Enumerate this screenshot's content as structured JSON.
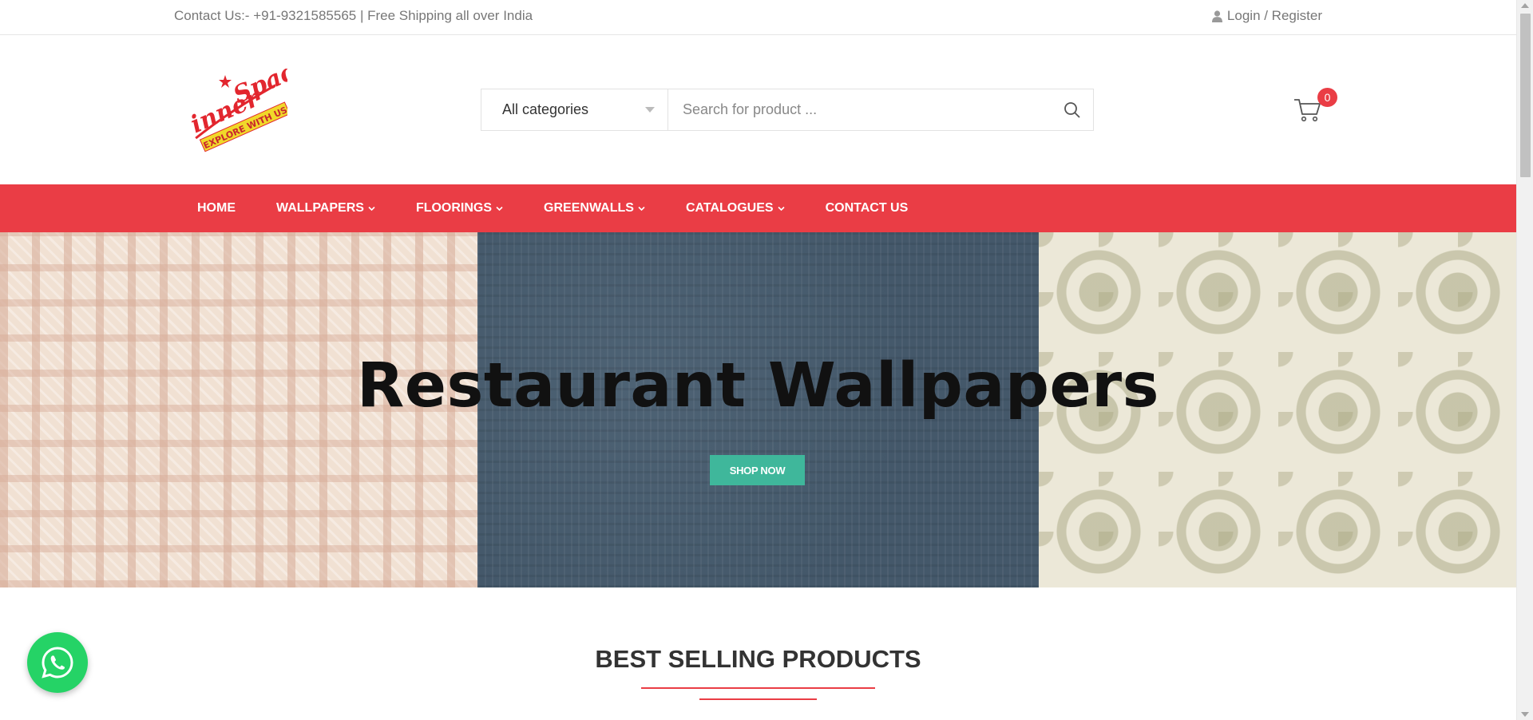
{
  "topbar": {
    "contact_text": "Contact Us:- +91-9321585565 | Free Shipping all over India",
    "login_text": "Login / Register",
    "login_icon": "user-icon"
  },
  "logo": {
    "brand_text": "innerSpace",
    "tagline": "EXPLORE WITH US"
  },
  "search": {
    "category_selected": "All categories",
    "placeholder": "Search for product ...",
    "icon": "search-icon"
  },
  "cart": {
    "icon": "cart-icon",
    "count": "0"
  },
  "nav": {
    "items": [
      {
        "label": "HOME",
        "dropdown": false
      },
      {
        "label": "WALLPAPERS",
        "dropdown": true
      },
      {
        "label": "FLOORINGS",
        "dropdown": true
      },
      {
        "label": "GREENWALLS",
        "dropdown": true
      },
      {
        "label": "CATALOGUES",
        "dropdown": true
      },
      {
        "label": "CONTACT US",
        "dropdown": false
      }
    ]
  },
  "hero": {
    "title": "Restaurant Wallpapers",
    "button_label": "SHOP NOW"
  },
  "section": {
    "title": "BEST SELLING PRODUCTS"
  },
  "whatsapp": {
    "icon": "whatsapp-icon"
  },
  "colors": {
    "accent_red": "#ea3d45",
    "button_teal": "#3fb79b",
    "whatsapp_green": "#25d366"
  }
}
